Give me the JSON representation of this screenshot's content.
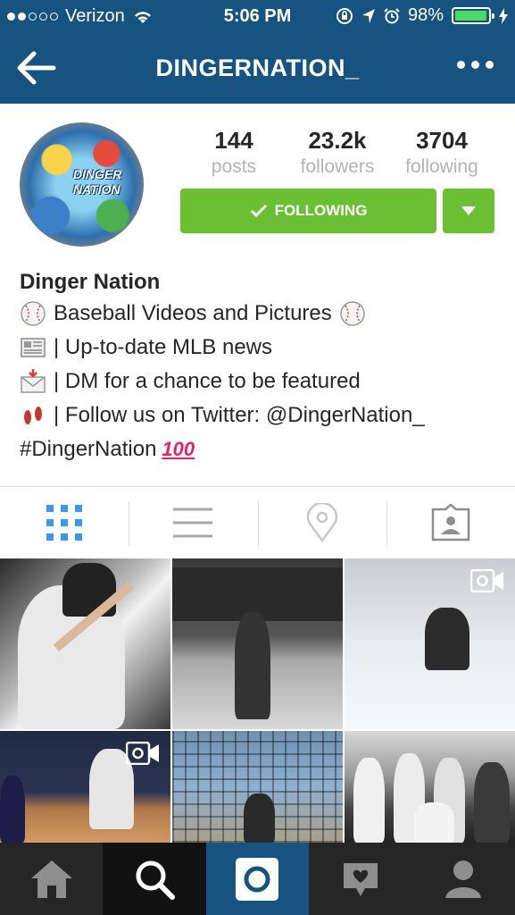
{
  "status_bar": {
    "carrier": "Verizon",
    "time": "5:06 PM",
    "battery": "98%",
    "battery_level": 0.98,
    "signal_bars_filled": 2,
    "signal_bars_total": 5
  },
  "nav": {
    "title": "DINGERNATION_",
    "back_icon": "back-arrow-icon",
    "more_icon": "more-options-icon"
  },
  "profile": {
    "avatar_text_1": "DINGER",
    "avatar_text_2": "NATION",
    "stats": [
      {
        "value": "144",
        "label": "posts"
      },
      {
        "value": "23.2k",
        "label": "followers"
      },
      {
        "value": "3704",
        "label": "following"
      }
    ],
    "follow_button": "FOLLOWING",
    "accent_color": "#6bbf33",
    "brand_color": "#175381"
  },
  "bio": {
    "name": "Dinger Nation",
    "lines": [
      {
        "icon": "baseball-icon",
        "text": "Baseball Videos and Pictures"
      },
      {
        "icon": "newspaper-icon",
        "text": "| Up-to-date MLB news"
      },
      {
        "icon": "envelope-icon",
        "text": "| DM for a chance to be featured"
      },
      {
        "icon": "footprints-icon",
        "text": "| Follow us on Twitter: @DingerNation_"
      }
    ],
    "hashtag": "#DingerNation",
    "hundred": "100"
  },
  "tabs": [
    {
      "name": "grid-view-icon",
      "active": true
    },
    {
      "name": "list-view-icon",
      "active": false
    },
    {
      "name": "location-icon",
      "active": false
    },
    {
      "name": "tagged-photos-icon",
      "active": false
    }
  ],
  "bottom_nav": [
    {
      "name": "home-icon"
    },
    {
      "name": "search-icon"
    },
    {
      "name": "camera-icon"
    },
    {
      "name": "activity-icon"
    },
    {
      "name": "profile-icon"
    }
  ]
}
